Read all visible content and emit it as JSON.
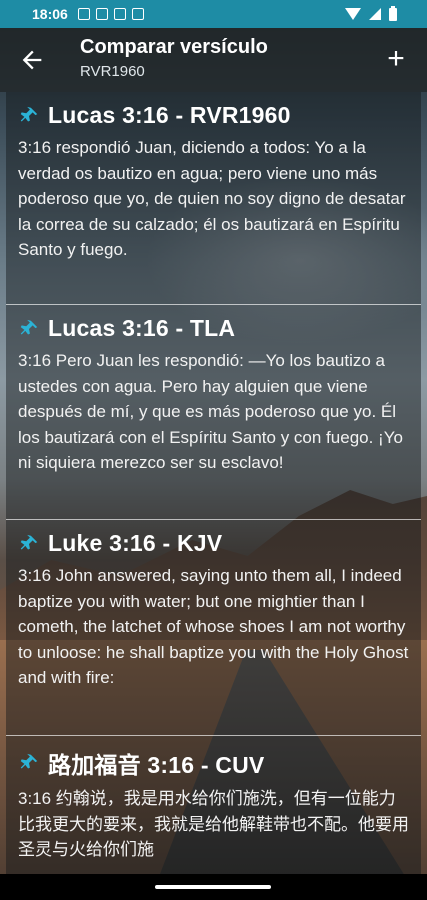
{
  "status_bar": {
    "time": "18:06"
  },
  "app_bar": {
    "title": "Comparar versículo",
    "subtitle": "RVR1960"
  },
  "verses": [
    {
      "reference": "Lucas 3:16 - RVR1960",
      "text": "3:16 respondió Juan, diciendo a todos: Yo a la verdad os bautizo en agua; pero viene uno más poderoso que yo, de quien no soy digno de desatar la correa de su calzado; él os bautizará en Espíritu Santo y fuego."
    },
    {
      "reference": "Lucas 3:16 - TLA",
      "text": "3:16 Pero Juan les respondió: —Yo los bautizo a ustedes con agua. Pero hay alguien que viene después de mí, y que es más poderoso que yo. Él los bautizará con el Espíritu Santo y con fuego. ¡Yo ni siquiera merezco ser su esclavo!"
    },
    {
      "reference": "Luke 3:16 - KJV",
      "text": "3:16 John answered, saying unto them all, I indeed baptize you with water; but one mightier than I cometh, the latchet of whose shoes I am not worthy to unloose: he shall baptize you with the Holy Ghost and with fire:"
    },
    {
      "reference": "路加福音 3:16 - CUV",
      "text": "3:16 约翰说，我是用水给你们施洗，但有一位能力比我更大的要来，我就是给他解鞋带也不配。他要用圣灵与火给你们施"
    }
  ],
  "colors": {
    "status_bar": "#1e8ca5",
    "pin_accent": "#2bb3d6"
  }
}
